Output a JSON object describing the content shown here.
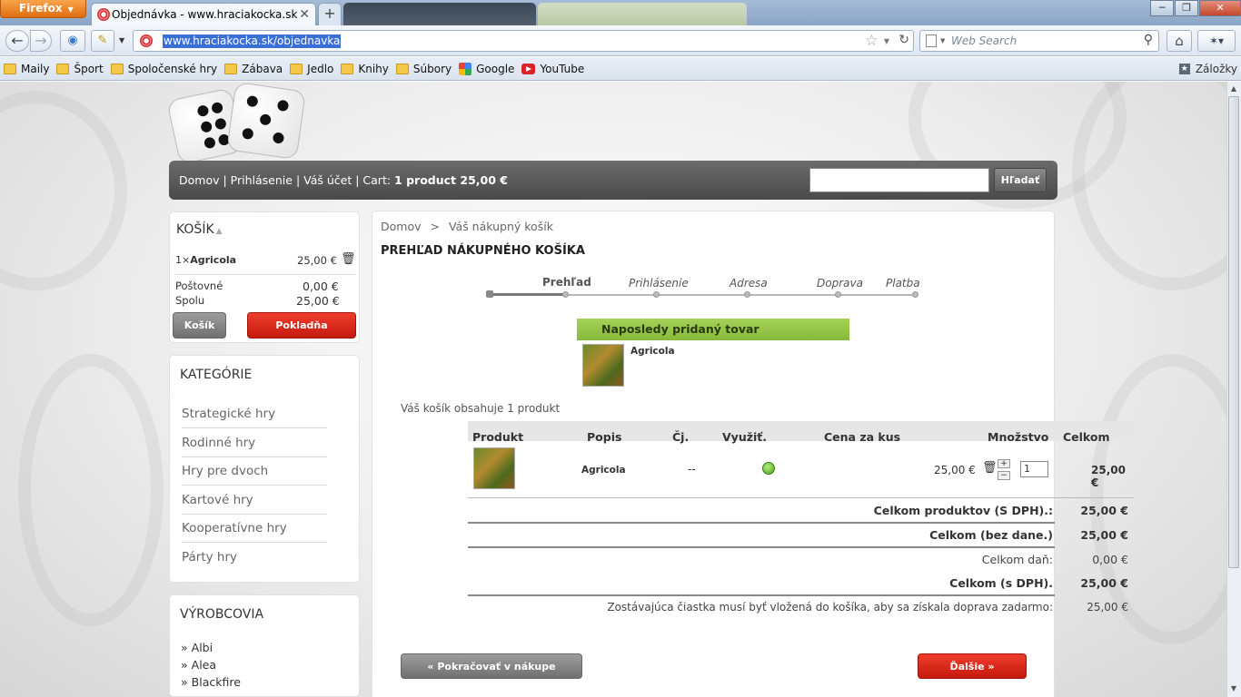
{
  "browser": {
    "app_button": "Firefox",
    "active_tab_title": "Objednávka - www.hraciakocka.sk",
    "url": "www.hraciakocka.sk/objednavka",
    "search_placeholder": "Web Search",
    "bookmarks": [
      "Maily",
      "Šport",
      "Spoločenské hry",
      "Zábava",
      "Jedlo",
      "Knihy",
      "Súbory",
      "Google",
      "YouTube"
    ],
    "bookmarks_right": "Záložky"
  },
  "site": {
    "nav": {
      "home": "Domov",
      "login": "Prihlásenie",
      "account": "Váš účet",
      "cart_label": "Cart:",
      "cart_summary": "1 product 25,00 €"
    },
    "search_button": "Hľadať"
  },
  "cart_box": {
    "title": "KOŠÍK",
    "item_qty": "1×",
    "item_name": "Agricola",
    "item_price": "25,00 €",
    "shipping_label": "Poštovné",
    "shipping_value": "0,00 €",
    "total_label": "Spolu",
    "total_value": "25,00 €",
    "cart_button": "Košík",
    "checkout_button": "Pokladňa"
  },
  "categories": {
    "title": "KATEGÓRIE",
    "items": [
      "Strategické hry",
      "Rodinné hry",
      "Hry pre dvoch",
      "Kartové hry",
      "Kooperatívne hry",
      "Párty hry"
    ]
  },
  "manufacturers": {
    "title": "VÝROBCOVIA",
    "items": [
      "Albi",
      "Alea",
      "Blackfire"
    ]
  },
  "main": {
    "breadcrumb_home": "Domov",
    "breadcrumb_sep": ">",
    "breadcrumb_current": "Váš nákupný košík",
    "heading": "PREHĽAD NÁKUPNÉHO KOŠÍKA",
    "steps": [
      "Prehľad",
      "Prihlásenie",
      "Adresa",
      "Doprava",
      "Platba"
    ],
    "last_added_title": "Naposledy pridaný tovar",
    "last_added_name": "Agricola",
    "cart_count_text": "Váš košík obsahuje 1 produkt",
    "table": {
      "headers": [
        "Produkt",
        "Popis",
        "Čj.",
        "Využiť.",
        "Cena za kus",
        "Množstvo",
        "Celkom"
      ],
      "row": {
        "name": "Agricola",
        "ref": "--",
        "unit_price": "25,00 €",
        "qty": "1",
        "total": "25,00 €"
      }
    },
    "totals": [
      {
        "label": "Celkom produktov (S DPH).:",
        "value": "25,00 €"
      },
      {
        "label": "Celkom (bez dane.)",
        "value": "25,00 €"
      },
      {
        "label": "Celkom daň:",
        "value": "0,00 €"
      },
      {
        "label": "Celkom (s DPH).",
        "value": "25,00 €"
      },
      {
        "label": "Zostávajúca čiastka musí byť vložená do košíka, aby sa získala doprava zadarmo:",
        "value": "25,00 €"
      }
    ],
    "continue_button": "« Pokračovať v nákupe",
    "next_button": "Ďalšie »"
  },
  "colors": {
    "accent_red": "#d0261a",
    "accent_green": "#8fc143"
  }
}
